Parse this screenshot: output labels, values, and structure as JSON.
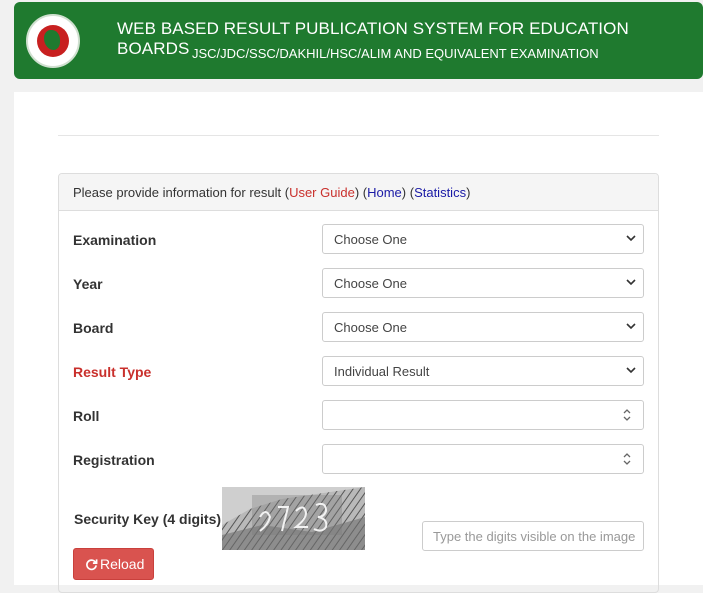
{
  "header": {
    "title": "WEB BASED RESULT PUBLICATION SYSTEM FOR EDUCATION BOARDS",
    "subtitle": "JSC/JDC/SSC/DAKHIL/HSC/ALIM AND EQUIVALENT EXAMINATION",
    "logo_icon": "government-seal-icon"
  },
  "panel": {
    "heading_text": "Please provide information for result",
    "links": {
      "user_guide": "User Guide",
      "home": "Home",
      "statistics": "Statistics"
    }
  },
  "form": {
    "examination": {
      "label": "Examination",
      "value": "Choose One"
    },
    "year": {
      "label": "Year",
      "value": "Choose One"
    },
    "board": {
      "label": "Board",
      "value": "Choose One"
    },
    "result_type": {
      "label": "Result Type",
      "value": "Individual Result"
    },
    "roll": {
      "label": "Roll",
      "value": ""
    },
    "registration": {
      "label": "Registration",
      "value": ""
    },
    "security": {
      "label": "Security Key (4 digits)",
      "placeholder": "Type the digits visible on the image"
    },
    "reload_label": "Reload"
  },
  "colors": {
    "header_bg": "#1f7a2f",
    "required_label": "#c9302c",
    "reload_bg": "#d9534f",
    "link_blue": "#1a1aa6"
  }
}
